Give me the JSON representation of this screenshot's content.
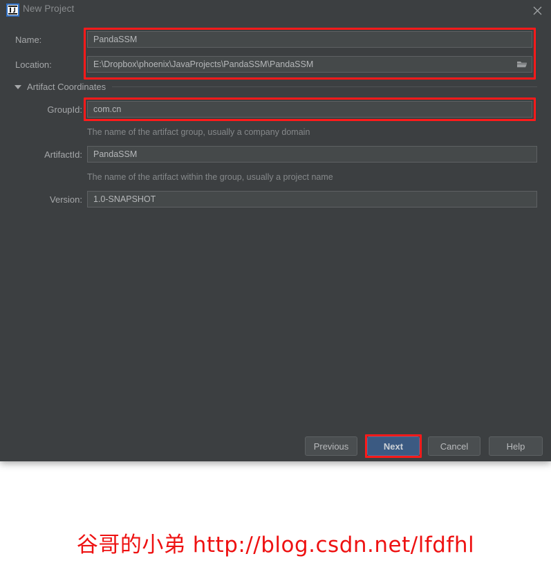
{
  "window": {
    "title": "New Project",
    "app_icon": "intellij-idea-icon",
    "close_label": "×"
  },
  "form": {
    "name": {
      "label": "Name:",
      "value": "PandaSSM",
      "placeholder": ""
    },
    "location": {
      "label": "Location:",
      "value": "E:\\Dropbox\\phoenix\\JavaProjects\\PandaSSM\\PandaSSM",
      "placeholder": "",
      "browse_icon": "folder-icon"
    }
  },
  "artifact_section": {
    "title": "Artifact Coordinates",
    "expanded": true,
    "group_id": {
      "label": "GroupId:",
      "value": "com.cn",
      "hint": "The name of the artifact group, usually a company domain"
    },
    "artifact_id": {
      "label": "ArtifactId:",
      "value": "PandaSSM",
      "hint": "The name of the artifact within the group, usually a project name"
    },
    "version": {
      "label": "Version:",
      "value": "1.0-SNAPSHOT",
      "hint": ""
    }
  },
  "footer": {
    "previous": "Previous",
    "next": "Next",
    "cancel": "Cancel",
    "help": "Help"
  },
  "watermark": {
    "text": "谷哥的小弟 http://blog.csdn.net/lfdfhl"
  },
  "colors": {
    "dialog_bg": "#3c3f41",
    "field_bg": "#45494a",
    "field_border": "#5e6163",
    "label": "#a6a8aa",
    "hint": "#85888a",
    "highlight": "#ff1a1a",
    "primary_button": "#3b5a82",
    "watermark": "#ee1111"
  }
}
